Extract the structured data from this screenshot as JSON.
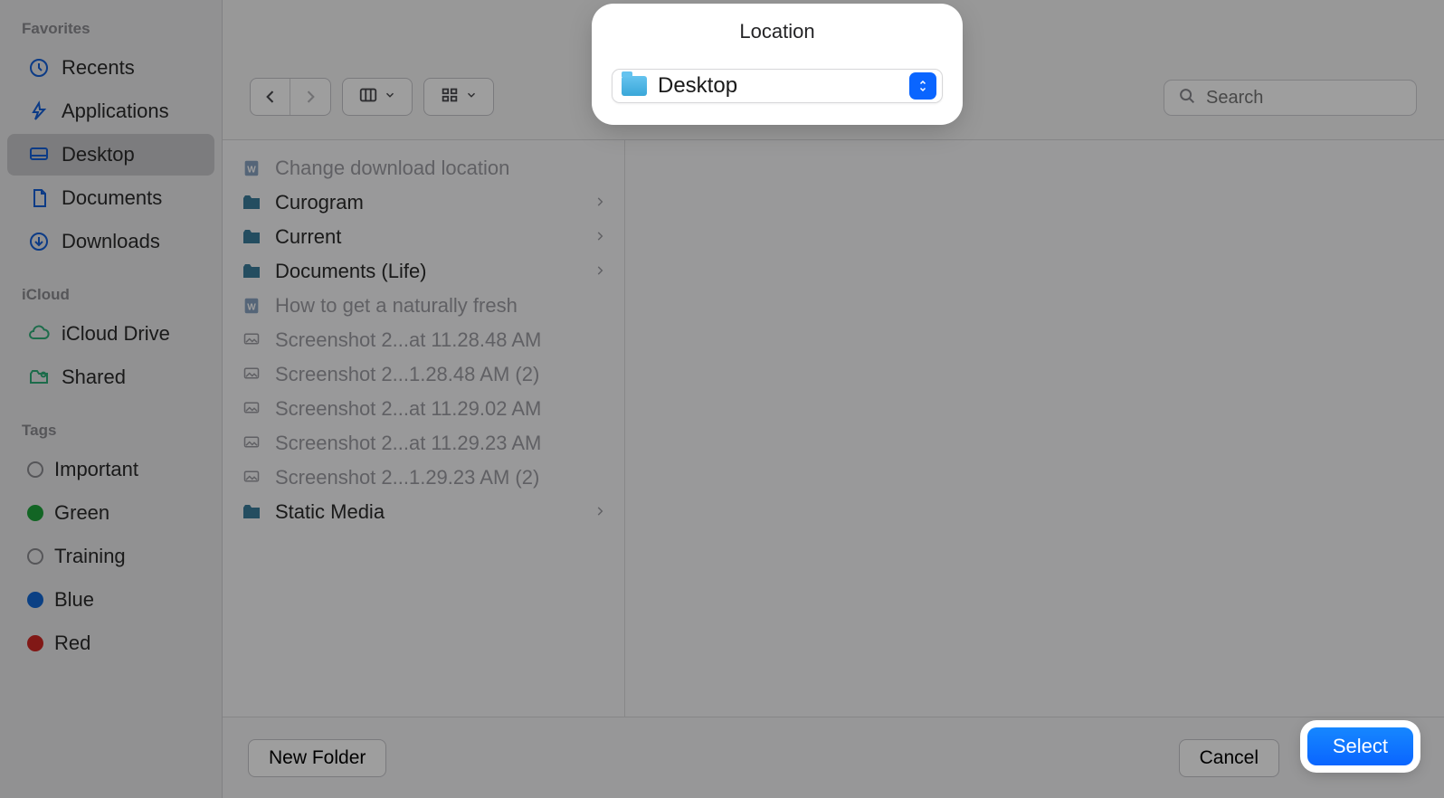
{
  "sidebar": {
    "sections": {
      "favorites": {
        "label": "Favorites",
        "items": [
          {
            "label": "Recents"
          },
          {
            "label": "Applications"
          },
          {
            "label": "Desktop"
          },
          {
            "label": "Documents"
          },
          {
            "label": "Downloads"
          }
        ]
      },
      "icloud": {
        "label": "iCloud",
        "items": [
          {
            "label": "iCloud Drive"
          },
          {
            "label": "Shared"
          }
        ]
      },
      "tags": {
        "label": "Tags",
        "items": [
          {
            "label": "Important"
          },
          {
            "label": "Green"
          },
          {
            "label": "Training"
          },
          {
            "label": "Blue"
          },
          {
            "label": "Red"
          }
        ]
      }
    }
  },
  "location": {
    "title": "Location",
    "selected": "Desktop"
  },
  "search": {
    "placeholder": "Search"
  },
  "filelist": [
    {
      "label": "Change download location",
      "type": "doc",
      "disabled": true
    },
    {
      "label": "Curogram",
      "type": "folder"
    },
    {
      "label": "Current",
      "type": "folder"
    },
    {
      "label": "Documents (Life)",
      "type": "folder"
    },
    {
      "label": "How to get a naturally fresh",
      "type": "doc",
      "disabled": true
    },
    {
      "label": "Screenshot 2...at 11.28.48 AM",
      "type": "img",
      "disabled": true
    },
    {
      "label": "Screenshot 2...1.28.48 AM (2)",
      "type": "img",
      "disabled": true
    },
    {
      "label": "Screenshot 2...at 11.29.02 AM",
      "type": "img",
      "disabled": true
    },
    {
      "label": "Screenshot 2...at 11.29.23 AM",
      "type": "img",
      "disabled": true
    },
    {
      "label": "Screenshot 2...1.29.23 AM (2)",
      "type": "img",
      "disabled": true
    },
    {
      "label": "Static Media",
      "type": "folder"
    }
  ],
  "footer": {
    "new_folder": "New Folder",
    "cancel": "Cancel",
    "select": "Select"
  }
}
